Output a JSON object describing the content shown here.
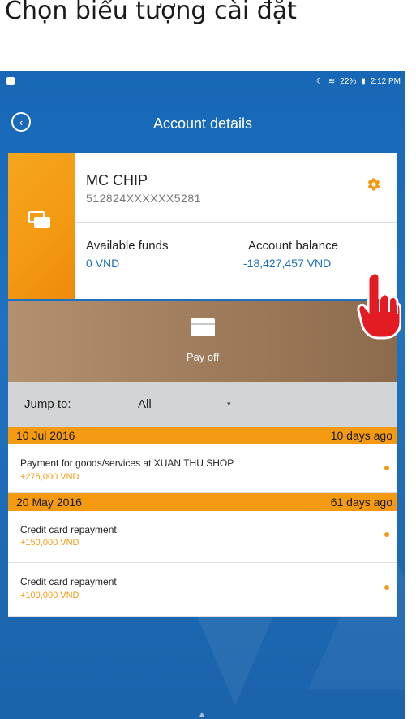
{
  "caption": {
    "text": "Chọn biểu tượng cài đặt"
  },
  "status_bar": {
    "right_text": "22%",
    "time": "2:12 PM",
    "icons": [
      "moon-icon",
      "wifi-icon",
      "battery-icon"
    ]
  },
  "header": {
    "title": "Account details",
    "back_icon": "chevron-left-circle-icon"
  },
  "card": {
    "name": "MC CHIP",
    "number": "512824XXXXXX5281",
    "available_funds_label": "Available funds",
    "available_funds_value": "0 VND",
    "account_balance_label": "Account balance",
    "account_balance_value": "-18,427,457 VND",
    "settings_icon": "gear-icon"
  },
  "payoff": {
    "label": "Pay off"
  },
  "jump": {
    "label": "Jump to:",
    "selected": "All"
  },
  "groups": [
    {
      "date": "10 Jul 2016",
      "ago": "10 days ago",
      "transactions": [
        {
          "description": "Payment for goods/services at XUAN THU SHOP",
          "amount": "+275,000 VND"
        }
      ]
    },
    {
      "date": "20 May 2016",
      "ago": "61 days ago",
      "transactions": [
        {
          "description": "Credit card repayment",
          "amount": "+150,000 VND"
        },
        {
          "description": "Credit card repayment",
          "amount": "+100,000 VND"
        }
      ]
    }
  ],
  "colors": {
    "accent": "#f39a12",
    "background": "#1767b6",
    "link": "#1a6fc3"
  }
}
